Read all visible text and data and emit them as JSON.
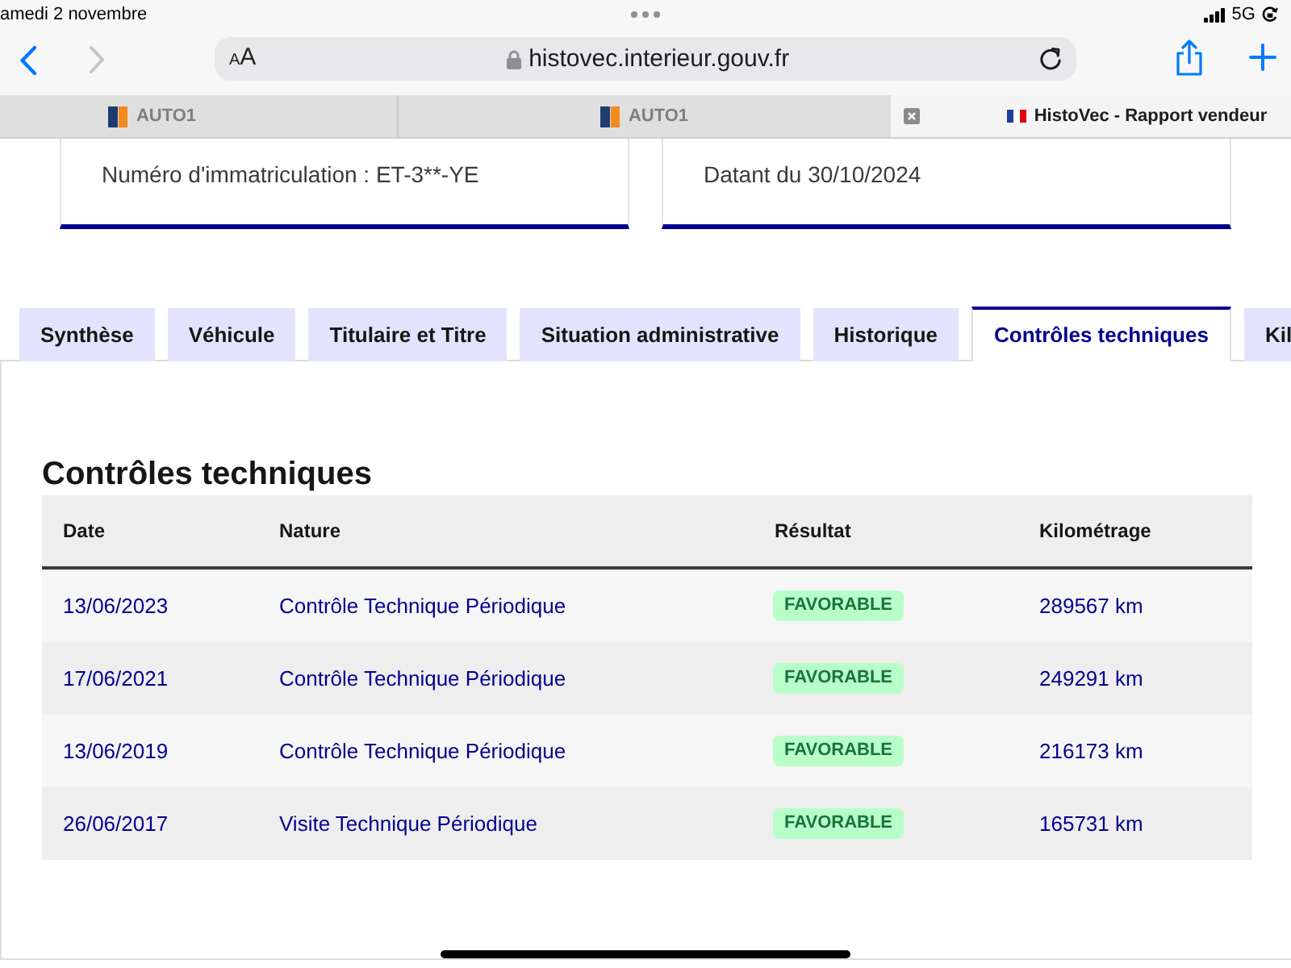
{
  "status_bar": {
    "date": "amedi 2 novembre",
    "network": "5G"
  },
  "toolbar": {
    "navigation": [
      {
        "kind": "back",
        "disabled": false
      },
      {
        "kind": "forward",
        "disabled": true
      }
    ],
    "text_size_label": "AA",
    "url": "histovec.interieur.gouv.fr"
  },
  "browser_tabs": [
    {
      "title": "AUTO1",
      "kind": "logo",
      "selected": false
    },
    {
      "title": "AUTO1",
      "kind": "logo",
      "selected": false
    },
    {
      "title": "HistoVec - Rapport vendeur",
      "kind": "flag",
      "selected": true
    }
  ],
  "summary_cards": [
    "Numéro d'immatriculation : ET-3**-YE",
    "Datant du 30/10/2024"
  ],
  "tabs": [
    {
      "label": "Synthèse",
      "selected": false
    },
    {
      "label": "Véhicule",
      "selected": false
    },
    {
      "label": "Titulaire et Titre",
      "selected": false
    },
    {
      "label": "Situation administrative",
      "selected": false
    },
    {
      "label": "Historique",
      "selected": false
    },
    {
      "label": "Contrôles techniques",
      "selected": true
    },
    {
      "label": "Kil",
      "selected": false
    }
  ],
  "section": {
    "title": "Contrôles techniques",
    "table": {
      "columns": [
        "Date",
        "Nature",
        "Résultat",
        "Kilométrage"
      ],
      "rows": [
        {
          "date": "13/06/2023",
          "nature": "Contrôle Technique Périodique",
          "result": "FAVORABLE",
          "mileage": "289567 km"
        },
        {
          "date": "17/06/2021",
          "nature": "Contrôle Technique Périodique",
          "result": "FAVORABLE",
          "mileage": "249291 km"
        },
        {
          "date": "13/06/2019",
          "nature": "Contrôle Technique Périodique",
          "result": "FAVORABLE",
          "mileage": "216173 km"
        },
        {
          "date": "26/06/2017",
          "nature": "Visite Technique Périodique",
          "result": "FAVORABLE",
          "mileage": "165731 km"
        }
      ]
    }
  }
}
